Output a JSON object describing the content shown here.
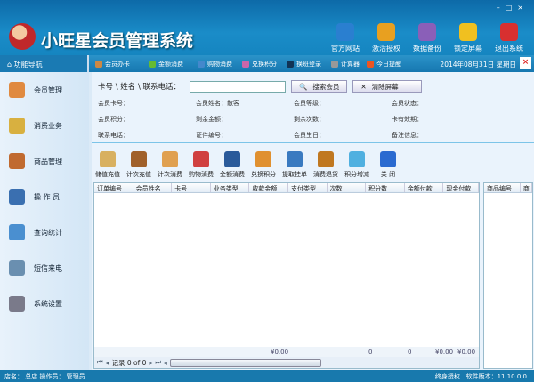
{
  "app": {
    "title": "小旺星会员管理系统",
    "window_controls": [
      "–",
      "□",
      "×"
    ]
  },
  "top_buttons": [
    {
      "label": "官方网站",
      "icon": "ie-icon",
      "color": "#2a7fd0"
    },
    {
      "label": "激活授权",
      "icon": "key-icon",
      "color": "#e8a020"
    },
    {
      "label": "数据备份",
      "icon": "floppy-icon",
      "color": "#8a5fb8"
    },
    {
      "label": "锁定屏幕",
      "icon": "lock-icon",
      "color": "#f0c020"
    },
    {
      "label": "退出系统",
      "icon": "power-icon",
      "color": "#d83030"
    }
  ],
  "nav": {
    "header": "功能导航",
    "quick": [
      {
        "label": "会员办卡",
        "color": "#c84"
      },
      {
        "label": "金额消费",
        "color": "#6b3"
      },
      {
        "label": "购物消费",
        "color": "#48c"
      },
      {
        "label": "兑换积分",
        "color": "#c6a"
      },
      {
        "label": "换班登录",
        "color": "#135"
      },
      {
        "label": "计算器",
        "color": "#999"
      },
      {
        "label": "今日提醒",
        "color": "#e52"
      }
    ],
    "date": "2014年08月31日",
    "weekday": "星期日"
  },
  "sidebar": [
    {
      "label": "会员管理",
      "color": "#e08a40"
    },
    {
      "label": "消费业务",
      "color": "#d8b040"
    },
    {
      "label": "商品管理",
      "color": "#c06a30"
    },
    {
      "label": "操 作 员",
      "color": "#3a6fb0"
    },
    {
      "label": "查询统计",
      "color": "#4a8fd0"
    },
    {
      "label": "短信来电",
      "color": "#6a8fb0"
    },
    {
      "label": "系统设置",
      "color": "#7a7a8a"
    }
  ],
  "search": {
    "label": "卡号 \\ 姓名 \\ 联系电话：",
    "value": "",
    "search_btn": "搜索会员",
    "clear_btn": "清除屏幕"
  },
  "info": [
    "会员卡号：",
    "会员姓名：散客",
    "会员等级：",
    "会员状态：",
    "会员积分：",
    "剩余金额：",
    "剩余次数：",
    "卡有效期：",
    "联系电话：",
    "证件编号：",
    "会员生日：",
    "备注信息："
  ],
  "tools": [
    {
      "label": "储值充值",
      "color": "#d8b060"
    },
    {
      "label": "计次充值",
      "color": "#a0602a"
    },
    {
      "label": "计次消费",
      "color": "#e0a050"
    },
    {
      "label": "购物消费",
      "color": "#d04040"
    },
    {
      "label": "金额消费",
      "color": "#2a5a9a"
    },
    {
      "label": "兑换积分",
      "color": "#e09030"
    },
    {
      "label": "提取挂单",
      "color": "#3a7ac0"
    },
    {
      "label": "消费退货",
      "color": "#c07820"
    },
    {
      "label": "积分增减",
      "color": "#50b0e0"
    },
    {
      "label": "关 闭",
      "color": "#2a6ad0"
    }
  ],
  "table": {
    "columns": [
      "订单编号",
      "会员姓名",
      "卡号",
      "业务类型",
      "收款金额",
      "支付类型",
      "次数",
      "积分数",
      "余额付款",
      "现金付款"
    ],
    "totals": {
      "amount": "¥0.00",
      "count": "0",
      "points": "0",
      "balance": "¥0.00",
      "cash": "¥0.00"
    },
    "pager": "记录 0 of 0"
  },
  "right_panel": {
    "columns": [
      "商品编号",
      "商"
    ]
  },
  "status": {
    "left": "店名： 总店   操作员： 管理员",
    "license": "终身授权",
    "version": "软件版本：11.10.0.0"
  }
}
